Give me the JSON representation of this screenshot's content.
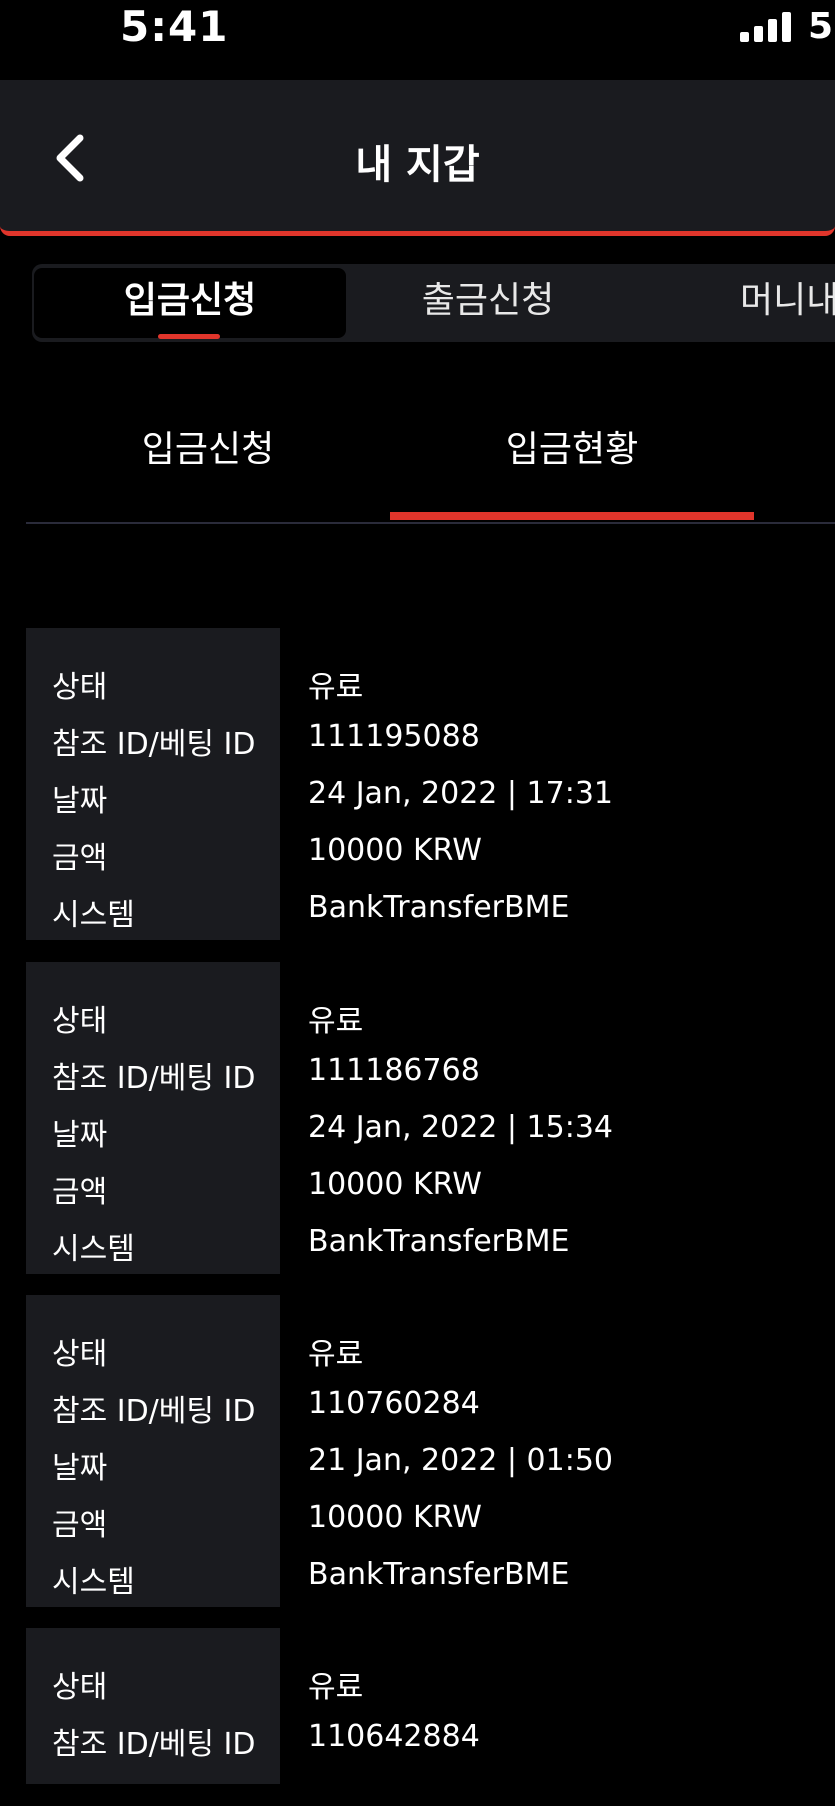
{
  "status_bar": {
    "time": "5:41",
    "battery": "5"
  },
  "header": {
    "title": "내 지갑"
  },
  "segments": [
    {
      "label": "입금신청",
      "active": true
    },
    {
      "label": "출금신청",
      "active": false
    },
    {
      "label": "머니내",
      "active": false
    }
  ],
  "subtabs": [
    {
      "label": "입금신청",
      "active": false
    },
    {
      "label": "입금현황",
      "active": true
    }
  ],
  "field_labels": {
    "status": "상태",
    "ref_id": "참조 ID/베팅 ID",
    "date": "날짜",
    "amount": "금액",
    "system": "시스템"
  },
  "transactions": [
    {
      "status": "유료",
      "ref_id": "111195088",
      "date": "24 Jan, 2022 | 17:31",
      "amount": "10000 KRW",
      "system": "BankTransferBME"
    },
    {
      "status": "유료",
      "ref_id": "111186768",
      "date": "24 Jan, 2022 | 15:34",
      "amount": "10000 KRW",
      "system": "BankTransferBME"
    },
    {
      "status": "유료",
      "ref_id": "110760284",
      "date": "21 Jan, 2022 | 01:50",
      "amount": "10000 KRW",
      "system": "BankTransferBME"
    },
    {
      "status": "유료",
      "ref_id": "110642884"
    }
  ],
  "colors": {
    "accent": "#e0352b",
    "panel": "#1a1b1f",
    "background": "#000000"
  }
}
